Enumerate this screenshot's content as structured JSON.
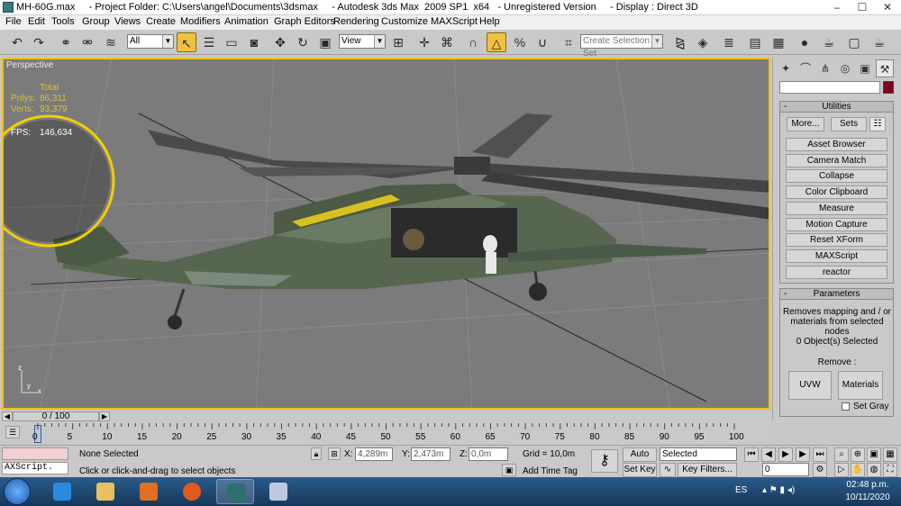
{
  "window": {
    "title": "MH-60G.max     - Project Folder: C:\\Users\\angel\\Documents\\3dsmax     - Autodesk 3ds Max  2009 SP1  x64   - Unregistered Version     - Display : Direct 3D",
    "minimize_glyph": "–",
    "maximize_glyph": "☐",
    "close_glyph": "✕"
  },
  "menu": [
    "File",
    "Edit",
    "Tools",
    "Group",
    "Views",
    "Create",
    "Modifiers",
    "Animation",
    "Graph Editors",
    "Rendering",
    "Customize",
    "MAXScript",
    "Help"
  ],
  "toolbar": {
    "selection_filter": "All",
    "reference_coord": "View",
    "named_selection_placeholder": "Create Selection Set",
    "icons": [
      "undo-icon",
      "redo-icon",
      "link-icon",
      "unlink-icon",
      "bind-space-warp-icon",
      "select-object-icon",
      "select-by-name-icon",
      "rect-region-icon",
      "window-crossing-icon",
      "move-icon",
      "rotate-icon",
      "scale-icon",
      "pivot-icon",
      "snap-3d-icon",
      "angle-snap-icon",
      "percent-snap-icon",
      "spinner-snap-icon",
      "edit-named-sel-icon",
      "mirror-icon",
      "align-icon",
      "layer-manager-icon",
      "curve-editor-icon",
      "schematic-icon",
      "material-editor-icon",
      "render-setup-icon",
      "render-frame-icon",
      "quick-render-icon"
    ]
  },
  "viewport": {
    "label": "Perspective",
    "stats": {
      "total_label": "Total",
      "polys_label": "Polys:",
      "polys_value": "86,311",
      "verts_label": "Verts:",
      "verts_value": "93,379",
      "fps_label": "FPS:",
      "fps_value": "146,634"
    },
    "axis_x": "x",
    "axis_y": "y",
    "axis_z": "z"
  },
  "command_panel": {
    "utilities_title": "Utilities",
    "more_label": "More...",
    "sets_label": "Sets",
    "buttons": [
      "Asset Browser",
      "Camera Match",
      "Collapse",
      "Color Clipboard",
      "Measure",
      "Motion Capture",
      "Reset XForm",
      "MAXScript",
      "reactor"
    ],
    "parameters_title": "Parameters",
    "description": "Removes mapping and / or materials from selected nodes",
    "selected_count": "0 Object(s) Selected",
    "remove_label": "Remove :",
    "uvw_label": "UVW",
    "materials_label": "Materials",
    "set_gray_label": "Set Gray",
    "collapse_glyph": "-"
  },
  "timeline": {
    "frame_label": "0 / 100",
    "ticks": [
      "0",
      "5",
      "10",
      "15",
      "20",
      "25",
      "30",
      "35",
      "40",
      "45",
      "50",
      "55",
      "60",
      "65",
      "70",
      "75",
      "80",
      "85",
      "90",
      "95",
      "100"
    ]
  },
  "status": {
    "maxscript_listener": "AXScript.",
    "selection": "None Selected",
    "prompt": "Click or click-and-drag to select objects",
    "x_label": "X:",
    "x_value": "4,289m",
    "y_label": "Y:",
    "y_value": "2,473m",
    "z_label": "Z:",
    "z_value": "0,0m",
    "grid": "Grid = 10,0m",
    "add_time_tag": "Add Time Tag",
    "auto_key": "Auto Key",
    "set_key": "Set Key",
    "key_mode": "Selected",
    "key_filters": "Key Filters...",
    "current_frame": "0"
  },
  "taskbar": {
    "language": "ES",
    "time": "02:48 p.m.",
    "date": "10/11/2020"
  }
}
